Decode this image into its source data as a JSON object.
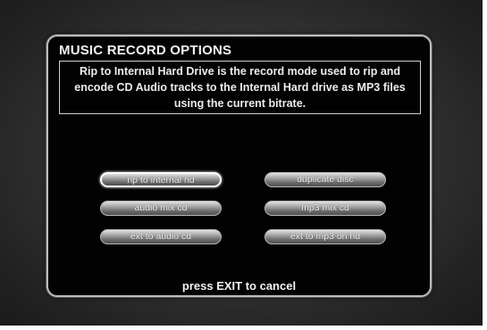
{
  "panel": {
    "title": "MUSIC RECORD OPTIONS",
    "description": "Rip to Internal Hard Drive is the record mode used to rip and encode CD Audio tracks to the Internal Hard drive as MP3 files using the current bitrate."
  },
  "buttons": {
    "rip_to_internal_hd": "rip to internal hd",
    "duplicate_disc": "duplicate disc",
    "audio_mix_cd": "audio mix cd",
    "mp3_mix_cd": "mp3 mix cd",
    "ext_to_audio_cd": "ext to audio cd",
    "ext_to_mp3_on_hd": "ext to mp3 on hd"
  },
  "selected_option": "rip to internal hd",
  "footer": {
    "exit_hint": "press EXIT to cancel"
  }
}
